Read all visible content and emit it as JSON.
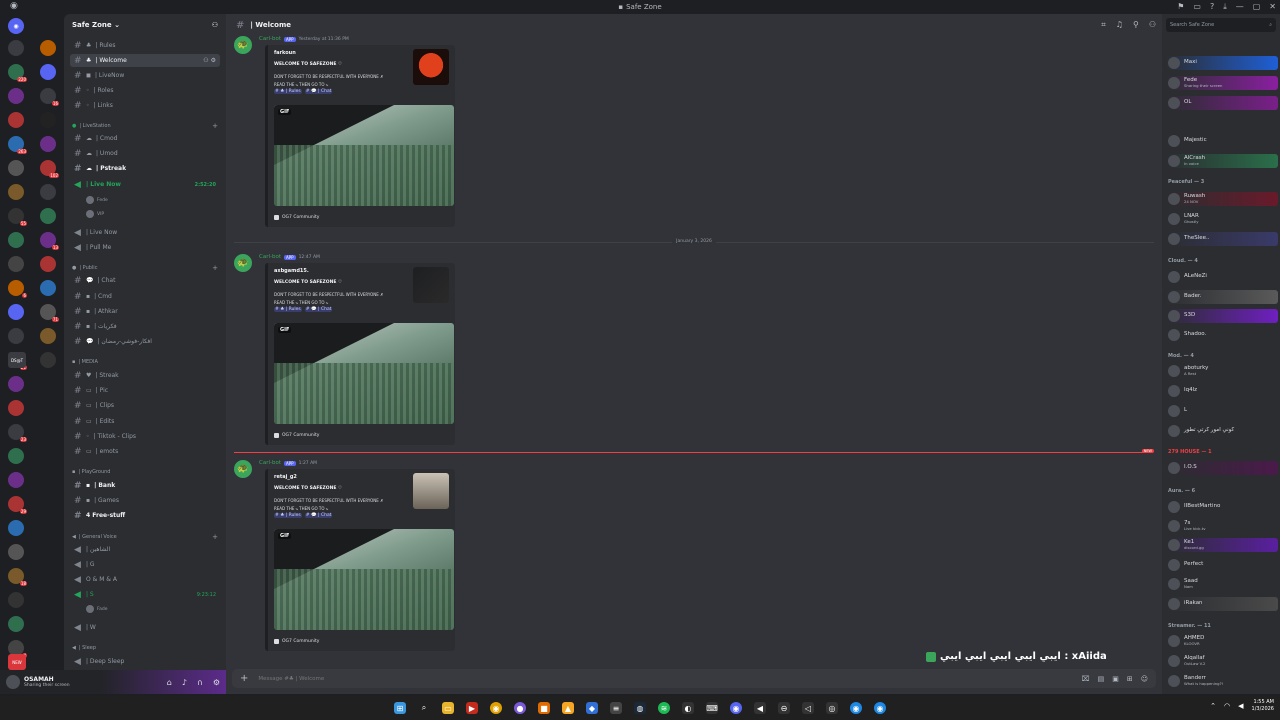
{
  "window": {
    "title": "Safe Zone",
    "title_icon": "discord-icon"
  },
  "colors": {
    "accent": "#5865f2",
    "bot_name": "#3ba55c",
    "new_divider": "#f23f43",
    "online": "#23a55a"
  },
  "server_rail": {
    "badges": [
      "220",
      "263",
      "55",
      "6",
      "21",
      "23",
      "29",
      "18",
      "4",
      "16",
      "102",
      "13",
      "71",
      "13",
      "14",
      "227"
    ],
    "labels": [
      "DS@T",
      "NEW"
    ]
  },
  "channels": {
    "guild_name": "Safe Zone",
    "guild_chevron": "chevron-down-icon",
    "top": [
      {
        "label": "| Rules"
      },
      {
        "label": "| Welcome"
      },
      {
        "label": "| LiveNow"
      },
      {
        "label": "| Roles"
      },
      {
        "label": "| Links"
      }
    ],
    "livestation": {
      "name": "| LiveStation",
      "items": [
        {
          "label": "| Cmod"
        },
        {
          "label": "| Umod"
        },
        {
          "label": "| Pstreak"
        },
        {
          "label": "| Live Now",
          "time": "2:52:20"
        },
        {
          "label": "| Live Now"
        },
        {
          "label": "| Pull Me"
        }
      ],
      "voice_users": [
        {
          "name": "Fede"
        },
        {
          "name": "VIP"
        }
      ]
    },
    "public": {
      "name": "| Public",
      "items": [
        {
          "label": "| Chat"
        },
        {
          "label": "| Cmd"
        },
        {
          "label": "| Athkar"
        },
        {
          "label": "| فكريات"
        },
        {
          "label": "| افكار-فوشي-رمضان"
        }
      ]
    },
    "media": {
      "name": "| MEDIA",
      "items": [
        {
          "label": "| Streak"
        },
        {
          "label": "| Pic"
        },
        {
          "label": "| Clips"
        },
        {
          "label": "| Edits"
        },
        {
          "label": "| Tiktok - Clips"
        },
        {
          "label": "| emots"
        }
      ]
    },
    "playground": {
      "name": "| PlayGround",
      "items": [
        {
          "label": "| Bank"
        },
        {
          "label": "| Games"
        },
        {
          "label": "4 Free-stuff"
        }
      ]
    },
    "general_voice": {
      "name": "| General Voice",
      "items": [
        {
          "label": "| الشاهين"
        },
        {
          "label": "| G"
        },
        {
          "label": "O & M & A"
        },
        {
          "label": "| S",
          "time": "9:23:12"
        },
        {
          "label": "| W"
        }
      ],
      "voice_users": [
        {
          "name": "Fade"
        }
      ]
    },
    "sleep": {
      "name": "| Sleep",
      "items": [
        {
          "label": "| Deep Sleep"
        }
      ]
    }
  },
  "user_panel": {
    "name": "OSAMAH",
    "status": "Sharing their screen"
  },
  "chat": {
    "channel_name": "| Welcome",
    "date_divider": "January 3, 2026",
    "new_label": "NEW",
    "messages": [
      {
        "author": "Carl-bot",
        "app_tag": "APP",
        "time": "Yesterday at 11:36 PM",
        "embed_user": "farkoun",
        "welcome": "WELCOME TO SAFEZONE ♡",
        "line1": "DON'T FORGET TO BE RESPECTFUL WITH EVERYONE ✗",
        "line2": "READ THE ⤷ THEN GO TO ⤷",
        "link1": "# ♣ | Rules",
        "link2": "# 💬 | Chat",
        "gif": "GIF",
        "footer": "OG7 Community"
      },
      {
        "author": "Carl-bot",
        "app_tag": "APP",
        "time": "12:47 AM",
        "embed_user": "axbgamd15.",
        "welcome": "WELCOME TO SAFEZONE ♡",
        "line1": "DON'T FORGET TO BE RESPECTFUL WITH EVERYONE ✗",
        "line2": "READ THE ⤷ THEN GO TO ⤷",
        "link1": "# ♣ | Rules",
        "link2": "# 💬 | Chat",
        "gif": "GIF",
        "footer": "OG7 Community"
      },
      {
        "author": "Carl-bot",
        "app_tag": "APP",
        "time": "1:27 AM",
        "embed_user": "retaj_g2",
        "welcome": "WELCOME TO SAFEZONE ♡",
        "line1": "DON'T FORGET TO BE RESPECTFUL WITH EVERYONE ✗",
        "line2": "READ THE ⤷ THEN GO TO ⤷",
        "link1": "# ♣ | Rules",
        "link2": "# 💬 | Chat",
        "gif": "GIF",
        "footer": "OG7 Community"
      }
    ],
    "overlay_text": "ايبي ايبي ايبي ايبي ايبي : xAiida",
    "composer_placeholder": "Message #♣ | Welcome"
  },
  "members": {
    "search_placeholder": "Search Safe Zone",
    "groups": [
      {
        "label": "Peaceful — 3"
      },
      {
        "label": "Cloud. — 4"
      },
      {
        "label": "Mod. — 4"
      },
      {
        "label": "279 HOUSE — 1"
      },
      {
        "label": "Aura. — 6"
      },
      {
        "label": "Streamer. — 11"
      }
    ],
    "list": [
      {
        "name": "Maxi",
        "sub": ""
      },
      {
        "name": "Fede",
        "sub": "Sharing their screen"
      },
      {
        "name": "OL",
        "sub": ""
      },
      {
        "name": "Majestic",
        "sub": ""
      },
      {
        "name": "AlCrash",
        "sub": "In voice"
      },
      {
        "name": "Ruwash",
        "sub": "24 NOV"
      },
      {
        "name": "LNAR",
        "sub": "Ghostly"
      },
      {
        "name": "TheSlee..",
        "sub": ""
      },
      {
        "name": "ALeNeZi",
        "sub": ""
      },
      {
        "name": "Bader.",
        "sub": ""
      },
      {
        "name": "S3D",
        "sub": ""
      },
      {
        "name": "Shadoo.",
        "sub": ""
      },
      {
        "name": "aboturky",
        "sub": "A Rest"
      },
      {
        "name": "Iq4lz",
        "sub": ""
      },
      {
        "name": "L",
        "sub": ""
      },
      {
        "name": "كوني امور كرتي تطور",
        "sub": ""
      },
      {
        "name": "I.O.S",
        "sub": ""
      },
      {
        "name": "IIBestMartino",
        "sub": ""
      },
      {
        "name": "7s",
        "sub": "Live kick.tv"
      },
      {
        "name": "Ke1",
        "sub": "discord.gg"
      },
      {
        "name": "Perfect",
        "sub": ""
      },
      {
        "name": "Saad",
        "sub": "Nam"
      },
      {
        "name": "iRakan",
        "sub": ""
      },
      {
        "name": "AHMED",
        "sub": "KLOOVR"
      },
      {
        "name": "Alqallaf",
        "sub": "OutLaw V.2"
      },
      {
        "name": "Banderr",
        "sub": "What is happening?!"
      }
    ]
  },
  "taskbar": {
    "time": "1:55 AM",
    "date": "1/3/2026"
  }
}
